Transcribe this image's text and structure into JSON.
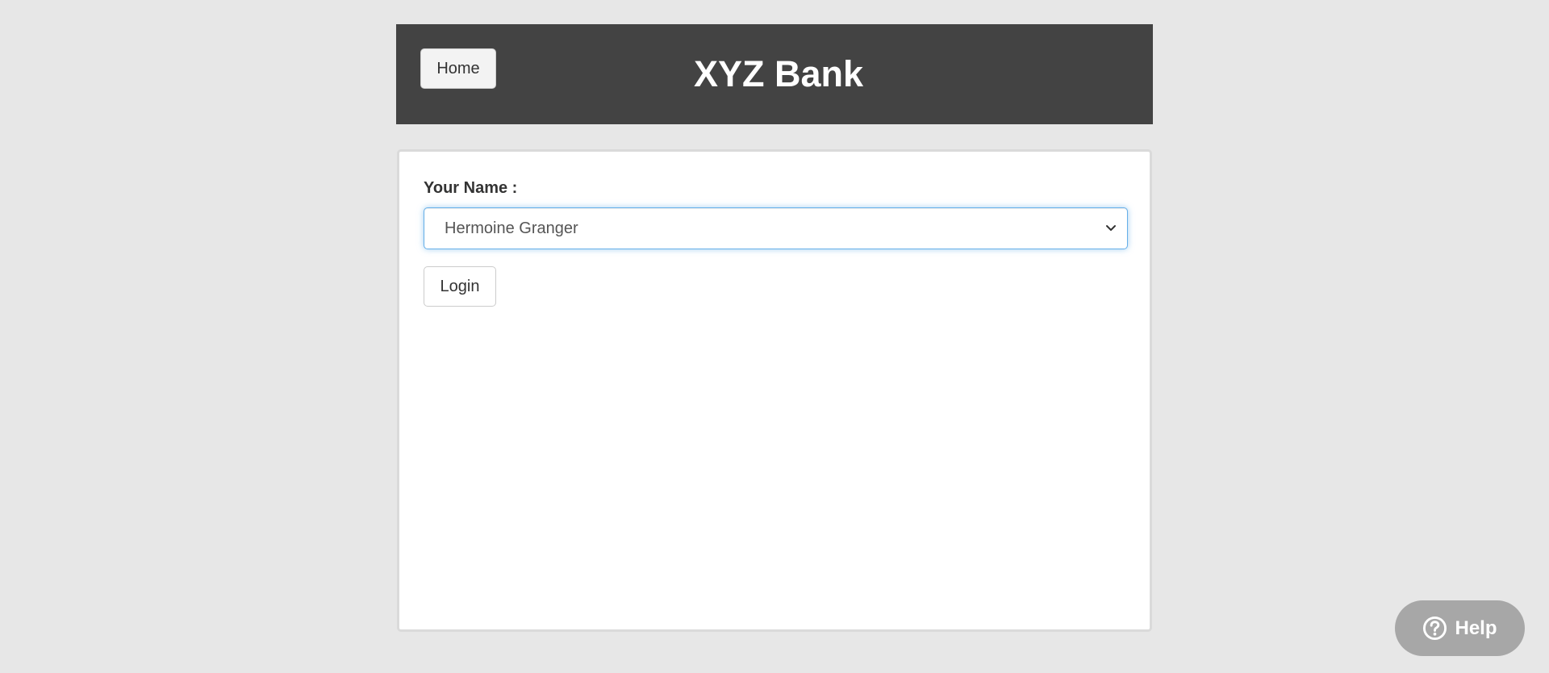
{
  "header": {
    "home_label": "Home",
    "title": "XYZ Bank",
    "background_color": "#434343"
  },
  "login_form": {
    "name_label": "Your Name :",
    "selected_customer": "Hermoine Granger",
    "login_label": "Login",
    "focus_color": "#66afe9"
  },
  "help_widget": {
    "label": "Help",
    "icon": "question-circle-icon",
    "background_color": "#a7a7a7"
  },
  "page": {
    "background_color": "#e7e7e7"
  }
}
